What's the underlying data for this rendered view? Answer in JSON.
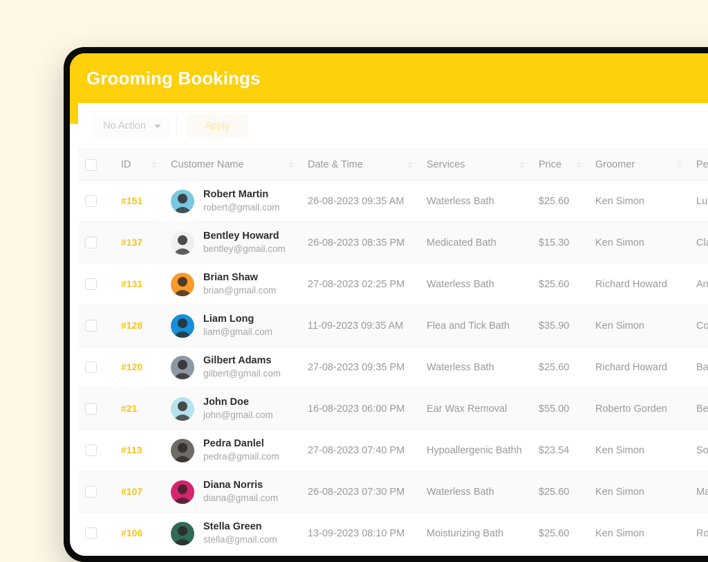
{
  "header": {
    "title": "Grooming Bookings",
    "background_color": "#FFD10D",
    "title_color": "#FFFFFF"
  },
  "page_background_color": "#FEF8E7",
  "toolbar": {
    "bulk_action_label": "No Action",
    "bulk_action_icon": "chevron-down-icon",
    "apply_label": "Apply",
    "apply_enabled": false
  },
  "table": {
    "columns": [
      {
        "key": "checkbox",
        "label": "",
        "sortable": false
      },
      {
        "key": "id",
        "label": "ID",
        "sortable": true
      },
      {
        "key": "customer",
        "label": "Customer Name",
        "sortable": true
      },
      {
        "key": "datetime",
        "label": "Date & Time",
        "sortable": true
      },
      {
        "key": "services",
        "label": "Services",
        "sortable": true
      },
      {
        "key": "price",
        "label": "Price",
        "sortable": true
      },
      {
        "key": "groomer",
        "label": "Groomer",
        "sortable": true
      },
      {
        "key": "pet",
        "label": "Pet",
        "sortable": false
      }
    ],
    "rows": [
      {
        "id": "#151",
        "name": "Robert Martin",
        "email": "robert@gmail.com",
        "datetime": "26-08-2023 09:35 AM",
        "service": "Waterless Bath",
        "price": "$25.60",
        "groomer": "Ken Simon",
        "pet": "Luna",
        "avatar_color": "#79C8E0"
      },
      {
        "id": "#137",
        "name": "Bentley Howard",
        "email": "bentley@gmail.com",
        "datetime": "26-08-2023 08:35 PM",
        "service": "Medicated Bath",
        "price": "$15.30",
        "groomer": "Ken Simon",
        "pet": "Clara",
        "avatar_color": "#EFEFEF"
      },
      {
        "id": "#131",
        "name": "Brian Shaw",
        "email": "brian@gmail.com",
        "datetime": "27-08-2023 02:25 PM",
        "service": "Waterless Bath",
        "price": "$25.60",
        "groomer": "Richard Howard",
        "pet": "Angel",
        "avatar_color": "#F79A2B"
      },
      {
        "id": "#128",
        "name": "Liam Long",
        "email": "liam@gmail.com",
        "datetime": "11-09-2023 09:35 AM",
        "service": "Flea and Tick Bath",
        "price": "$35.90",
        "groomer": "Ken Simon",
        "pet": "Colt",
        "avatar_color": "#168FD6"
      },
      {
        "id": "#120",
        "name": "Gilbert Adams",
        "email": "gilbert@gmail.com",
        "datetime": "27-08-2023 09:35 PM",
        "service": "Waterless Bath",
        "price": "$25.60",
        "groomer": "Richard Howard",
        "pet": "Bailey",
        "avatar_color": "#8C98A6"
      },
      {
        "id": "#21",
        "name": "John Doe",
        "email": "john@gmail.com",
        "datetime": "16-08-2023 06:00 PM",
        "service": "Ear Wax Removal",
        "price": "$55.00",
        "groomer": "Roberto Gorden",
        "pet": "Bear",
        "avatar_color": "#B6E2F0"
      },
      {
        "id": "#113",
        "name": "Pedra Danlel",
        "email": "pedra@gmail.com",
        "datetime": "27-08-2023 07:40 PM",
        "service": "Hypoallergenic Bathh",
        "price": "$23.54",
        "groomer": "Ken Simon",
        "pet": "Sophie",
        "avatar_color": "#6E6A66"
      },
      {
        "id": "#107",
        "name": "Diana Norris",
        "email": "diana@gmail.com",
        "datetime": "26-08-2023 07:30 PM",
        "service": "Waterless Bath",
        "price": "$25.60",
        "groomer": "Ken Simon",
        "pet": "Max",
        "avatar_color": "#D6246E"
      },
      {
        "id": "#106",
        "name": "Stella Green",
        "email": "stella@gmail.com",
        "datetime": "13-09-2023 08:10 PM",
        "service": "Moisturizing Bath",
        "price": "$25.60",
        "groomer": "Ken Simon",
        "pet": "Rocky",
        "avatar_color": "#2F6B55"
      }
    ]
  },
  "accent_colors": {
    "id_link": "#F5C518",
    "header_yellow": "#FFD10D"
  }
}
